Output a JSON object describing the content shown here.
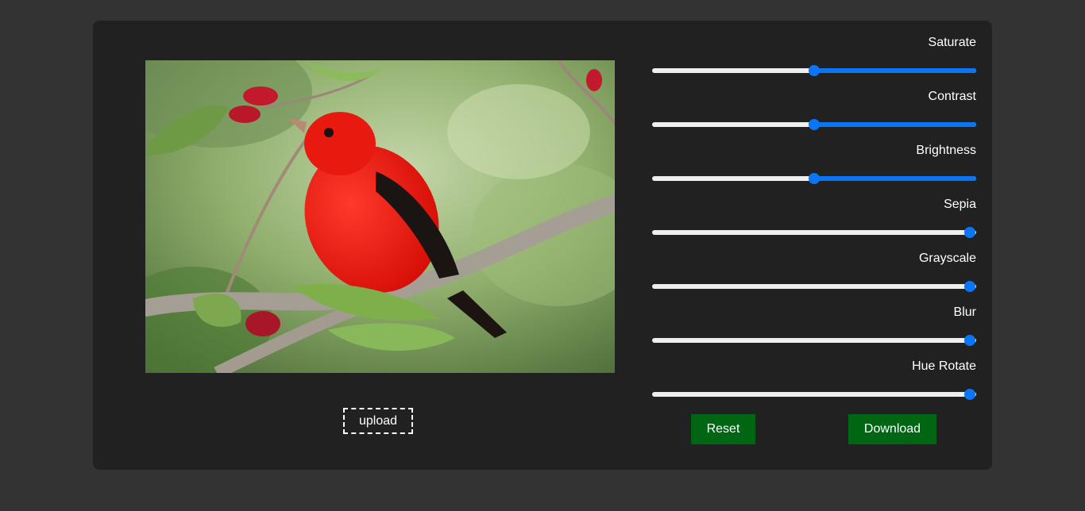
{
  "upload": {
    "label": "upload"
  },
  "sliders": [
    {
      "label": "Saturate",
      "value": 0.5,
      "filled": "right"
    },
    {
      "label": "Contrast",
      "value": 0.5,
      "filled": "right"
    },
    {
      "label": "Brightness",
      "value": 0.5,
      "filled": "right"
    },
    {
      "label": "Sepia",
      "value": 0.98,
      "filled": "none"
    },
    {
      "label": "Grayscale",
      "value": 0.98,
      "filled": "none"
    },
    {
      "label": "Blur",
      "value": 0.98,
      "filled": "none"
    },
    {
      "label": "Hue Rotate",
      "value": 0.98,
      "filled": "none"
    }
  ],
  "buttons": {
    "reset": "Reset",
    "download": "Download"
  },
  "colors": {
    "background": "#333333",
    "card": "#212121",
    "accent": "#0b76f5",
    "button": "#006614"
  }
}
